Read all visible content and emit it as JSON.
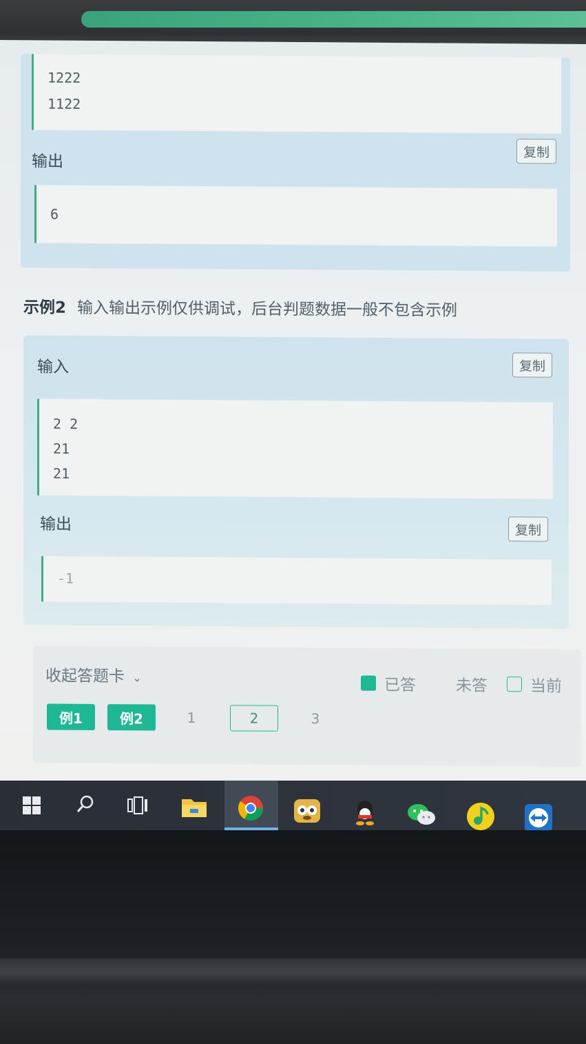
{
  "example1": {
    "input_lines": [
      "1222",
      "1122"
    ],
    "output_label": "输出",
    "copy_label": "复制",
    "output_lines": [
      "6"
    ]
  },
  "example2": {
    "title_prefix": "示例2",
    "title_note": "输入输出示例仅供调试，后台判题数据一般不包含示例",
    "input_label": "输入",
    "input_copy_label": "复制",
    "input_lines": [
      "2 2",
      "21",
      "21"
    ],
    "output_label": "输出",
    "output_copy_label": "复制",
    "output_lines": [
      "-1"
    ]
  },
  "answer_card": {
    "collapse_label": "收起答题卡",
    "legend": {
      "answered": "已答",
      "unanswered": "未答",
      "current": "当前"
    },
    "items": [
      "例1",
      "例2",
      "1",
      "2",
      "3"
    ],
    "colors": {
      "answered": "#1fb894",
      "current_border": "#1fb894"
    }
  },
  "taskbar": {
    "icons": [
      "windows-start-icon",
      "search-icon",
      "task-view-icon",
      "file-explorer-icon",
      "chrome-icon",
      "raccoon-app-icon",
      "qq-icon",
      "wechat-icon",
      "qq-music-icon",
      "teamviewer-icon"
    ]
  }
}
